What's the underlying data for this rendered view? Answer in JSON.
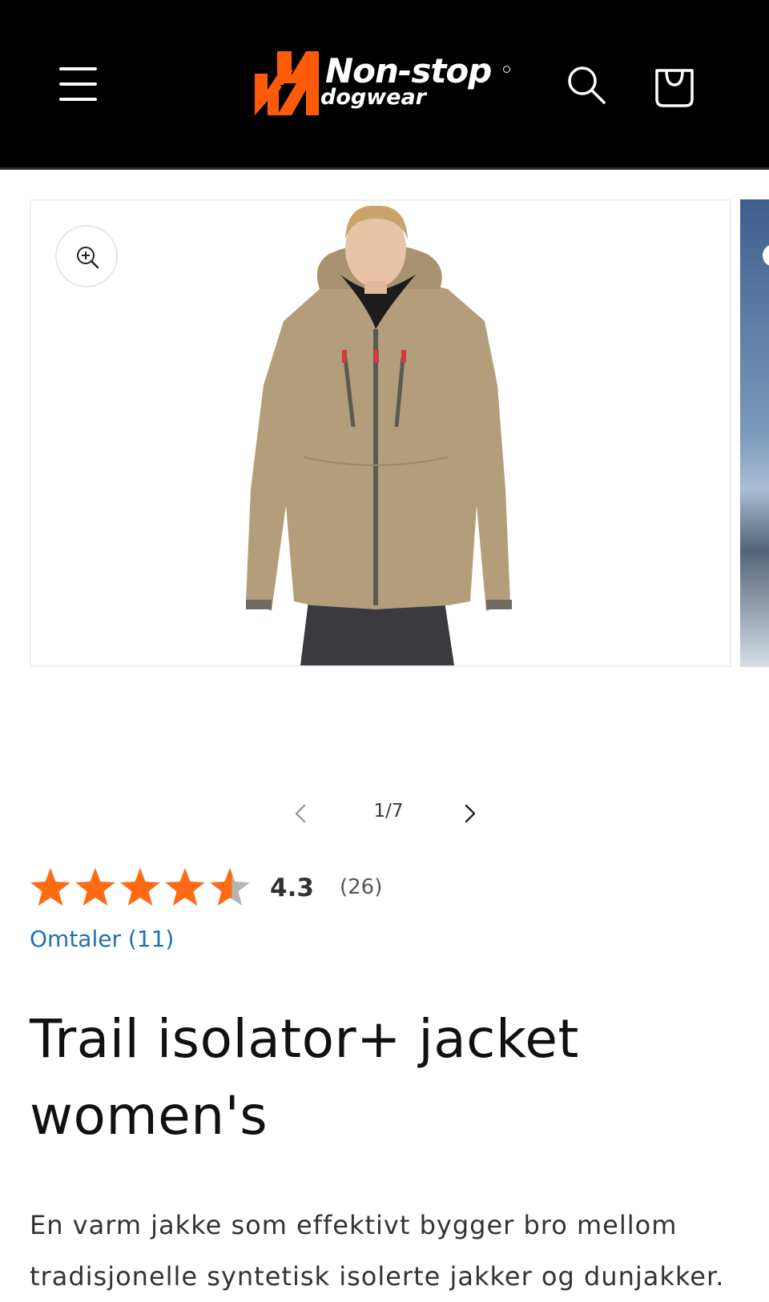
{
  "header": {
    "menu_icon": "hamburger-menu-icon",
    "logo": {
      "name": "Non-stop",
      "sub": "dogwear",
      "mark": "®",
      "accent": "#ff5a0a"
    },
    "search_icon": "search-icon",
    "cart_icon": "shopping-bag-icon"
  },
  "gallery": {
    "zoom_icon": "zoom-in-icon",
    "current": 1,
    "total": 7,
    "counter": "1/7",
    "prev_icon": "chevron-left-icon",
    "next_icon": "chevron-right-icon"
  },
  "rating": {
    "value": "4.3",
    "count": "(26)",
    "stars_filled": 4.3,
    "stars_total": 5,
    "star_color": "#ff6a14",
    "empty_star_color": "#b5b5b5"
  },
  "reviews_link": "Omtaler (11)",
  "product": {
    "title": "Trail isolator+ jacket women's",
    "description": "En varm jakke som effektivt bygger bro mellom tradisjonelle syntetisk isolerte jakker og dunjakker."
  },
  "colors": {
    "header_bg": "#000000",
    "link": "#1f6fb2"
  }
}
